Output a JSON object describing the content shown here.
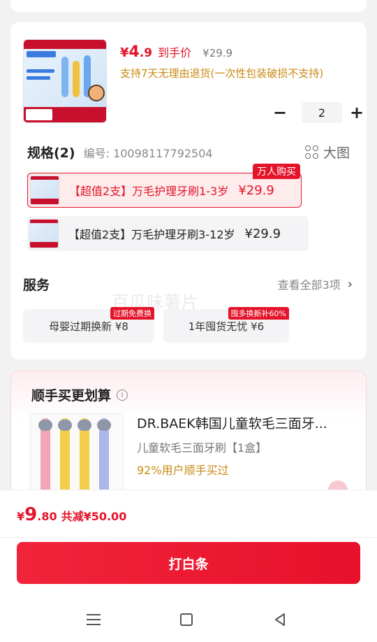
{
  "product": {
    "price_currency": "¥",
    "price_int": "4",
    "price_dec": ".9",
    "price_tag": "到手价",
    "original_price": "¥29.9",
    "return_policy": "支持7天无理由退货(一次性包装破损不支持)",
    "quantity": "2",
    "minus_label": "−",
    "plus_label": "+"
  },
  "spec": {
    "title": "规格(2)",
    "number": "编号: 10098117792504",
    "big_image_label": "大图",
    "hot_badge": "万人购买",
    "options": [
      {
        "label": "【超值2支】万毛护理牙刷1-3岁",
        "price": "¥29.9",
        "selected": true
      },
      {
        "label": "【超值2支】万毛护理牙刷3-12岁",
        "price": "¥29.9",
        "selected": false
      }
    ]
  },
  "service": {
    "title": "服务",
    "view_all": "查看全部3项",
    "chevron": "›",
    "watermark": "百瓜味薯片",
    "items": [
      {
        "label": "母婴过期换新 ¥8",
        "badge": "过期免费换"
      },
      {
        "label": "1年囤货无忧 ¥6",
        "badge": "囤多换新补60%"
      }
    ]
  },
  "recommend": {
    "title": "顺手买更划算",
    "info_icon": "i",
    "item": {
      "name": "DR.BAEK韩国儿童软毛三面牙...",
      "sub": "儿童软毛三面牙刷【1盒】",
      "percent": "92%用户顺手买过"
    }
  },
  "checkout": {
    "total_currency": "¥",
    "total_int": "9",
    "total_dec": ".80",
    "save_text": "共减¥50.00",
    "pay_button": "打白条"
  },
  "colors": {
    "accent": "#e4142a",
    "gold": "#c98a14"
  }
}
